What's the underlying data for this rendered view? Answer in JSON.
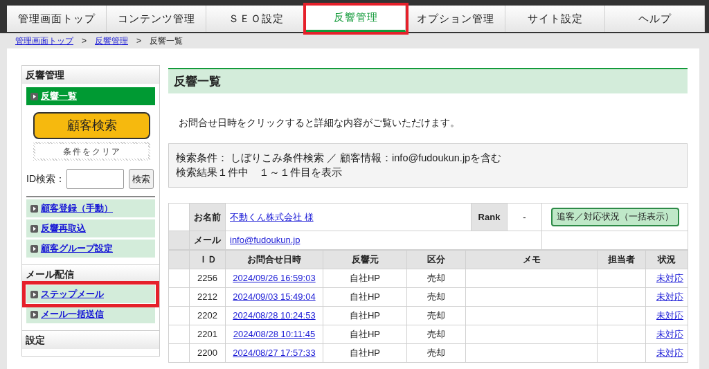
{
  "nav": {
    "tabs": [
      {
        "label": "管理画面トップ",
        "selected": false,
        "highlighted": false
      },
      {
        "label": "コンテンツ管理",
        "selected": false,
        "highlighted": false
      },
      {
        "label": "ＳＥＯ設定",
        "selected": false,
        "highlighted": false
      },
      {
        "label": "反響管理",
        "selected": true,
        "highlighted": true
      },
      {
        "label": "オプション管理",
        "selected": false,
        "highlighted": false
      },
      {
        "label": "サイト設定",
        "selected": false,
        "highlighted": false
      },
      {
        "label": "ヘルプ",
        "selected": false,
        "highlighted": false
      }
    ]
  },
  "breadcrumb": [
    {
      "kind": "link",
      "label": "管理画面トップ"
    },
    {
      "kind": "separator",
      "label": ">"
    },
    {
      "kind": "link",
      "label": "反響管理"
    },
    {
      "kind": "separator",
      "label": ">"
    },
    {
      "kind": "current",
      "label": "反響一覧"
    }
  ],
  "sidebar": {
    "sections": [
      {
        "title": "反響管理",
        "items": [
          {
            "kind": "link",
            "label": "反響一覧",
            "selected": true,
            "highlighted": false
          },
          {
            "kind": "search_button",
            "label": "顧客検索"
          },
          {
            "kind": "clear_button",
            "label": "条件をクリア"
          },
          {
            "kind": "id_search",
            "label": "ID検索：",
            "button": "検索"
          },
          {
            "kind": "link",
            "label": "顧客登録（手動）",
            "selected": false,
            "highlighted": false
          },
          {
            "kind": "link",
            "label": "反響再取込",
            "selected": false,
            "highlighted": false
          },
          {
            "kind": "link",
            "label": "顧客グループ設定",
            "selected": false,
            "highlighted": false
          }
        ]
      },
      {
        "title": "メール配信",
        "items": [
          {
            "kind": "link",
            "label": "ステップメール",
            "selected": false,
            "highlighted": true
          },
          {
            "kind": "link",
            "label": "メール一括送信",
            "selected": false,
            "highlighted": false
          }
        ]
      },
      {
        "title": "設定"
      }
    ]
  },
  "main": {
    "title": "反響一覧",
    "notice": "お問合せ日時をクリックすると詳細な内容がご覧いただけます。",
    "search_summary": {
      "condition": "検索条件： しぼりこみ条件検索 ／ 顧客情報：info@fudoukun.jpを含む",
      "result": "検索結果１件中　１～１件目を表示"
    }
  },
  "customer": {
    "name_label": "お名前",
    "name": "不動くん株式会社 様",
    "rank_label": "Rank",
    "rank": "-",
    "status_button": "追客／対応状況（一括表示）",
    "mail_label": "メール",
    "email": "info@fudoukun.jp"
  },
  "table": {
    "columns": [
      "ＩＤ",
      "お問合せ日時",
      "反響元",
      "区分",
      "メモ",
      "担当者",
      "状況"
    ],
    "rows": [
      {
        "id": "2256",
        "date": "2024/09/26 16:59:03",
        "source": "自社HP",
        "category": "売却",
        "status": "未対応"
      },
      {
        "id": "2212",
        "date": "2024/09/03 15:49:04",
        "source": "自社HP",
        "category": "売却",
        "status": "未対応"
      },
      {
        "id": "2202",
        "date": "2024/08/28 10:24:53",
        "source": "自社HP",
        "category": "売却",
        "status": "未対応"
      },
      {
        "id": "2201",
        "date": "2024/08/28 10:11:45",
        "source": "自社HP",
        "category": "売却",
        "status": "未対応"
      },
      {
        "id": "2200",
        "date": "2024/08/27 17:57:33",
        "source": "自社HP",
        "category": "売却",
        "status": "未対応"
      }
    ]
  }
}
